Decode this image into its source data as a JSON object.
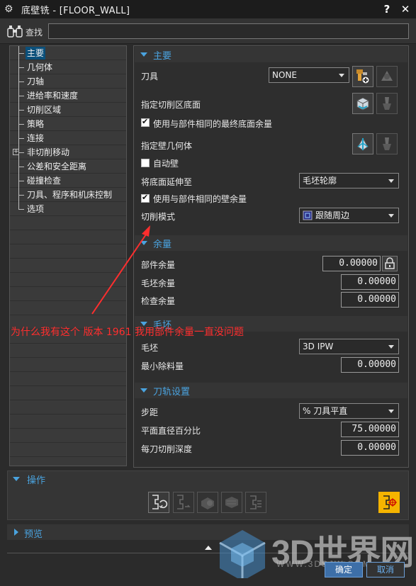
{
  "window": {
    "title": "底壁铣 - [FLOOR_WALL]",
    "help": "?",
    "close": "✕"
  },
  "find": {
    "label": "查找",
    "value": ""
  },
  "tree": {
    "items": [
      {
        "label": "主要",
        "selected": true
      },
      {
        "label": "几何体"
      },
      {
        "label": "刀轴"
      },
      {
        "label": "进给率和速度"
      },
      {
        "label": "切削区域"
      },
      {
        "label": "策略"
      },
      {
        "label": "连接"
      },
      {
        "label": "非切削移动",
        "expandable": true
      },
      {
        "label": "公差和安全距离"
      },
      {
        "label": "碰撞检查"
      },
      {
        "label": "刀具、程序和机床控制"
      },
      {
        "label": "选项"
      }
    ]
  },
  "main": {
    "header": "主要",
    "tool_label": "刀具",
    "tool_value": "NONE",
    "floor_label": "指定切削区底面",
    "use_final_floor_stock": "使用与部件相同的最终底面余量",
    "wall_geom_label": "指定壁几何体",
    "auto_wall": "自动壁",
    "extend_floor_label": "将底面延伸至",
    "extend_floor_value": "毛坯轮廓",
    "use_wall_stock": "使用与部件相同的壁余量",
    "cut_pattern_label": "切削模式",
    "cut_pattern_value": "跟随周边"
  },
  "stock": {
    "header": "余量",
    "part_stock_label": "部件余量",
    "part_stock_value": "0.00000",
    "blank_stock_label": "毛坯余量",
    "blank_stock_value": "0.00000",
    "check_stock_label": "检查余量",
    "check_stock_value": "0.00000"
  },
  "blank": {
    "header": "毛坯",
    "blank_label": "毛坯",
    "blank_value": "3D IPW",
    "min_removal_label": "最小除料量",
    "min_removal_value": "0.00000"
  },
  "toolpath": {
    "header": "刀轨设置",
    "stepover_label": "步距",
    "stepover_value": "% 刀具平直",
    "percent_label": "平面直径百分比",
    "percent_value": "75.00000",
    "depth_label": "每刀切削深度",
    "depth_value": "0.00000"
  },
  "actions": {
    "header": "操作"
  },
  "preview": {
    "header": "预览"
  },
  "buttons": {
    "ok": "确定",
    "cancel": "取消"
  },
  "annotation": {
    "text": "为什么我有这个  版本 1961  我用部件余量一直没问题"
  },
  "watermark": {
    "text": "3D世界网",
    "url": "WWW.3DSJW.COM"
  },
  "colors": {
    "accent": "#4aa3df",
    "selection": "#0a4f7a",
    "annotation": "#ff2e2e",
    "ok": "#3d6fa8"
  }
}
